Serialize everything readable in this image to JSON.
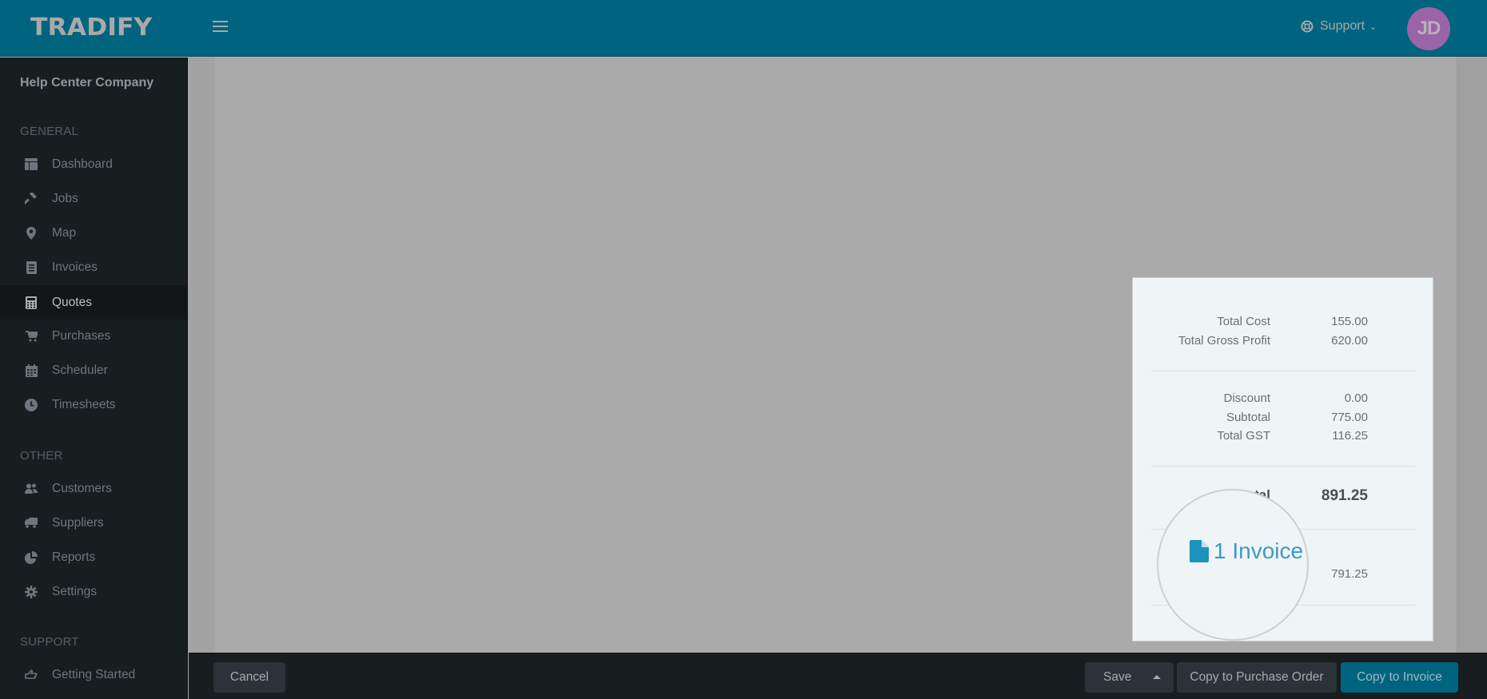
{
  "header": {
    "logo": "TRADIFY",
    "support_label": "Support",
    "avatar_initials": "JD",
    "avatar_color": "#9b64a7",
    "brand_color": "#00637f"
  },
  "sidebar": {
    "company": "Help Center Company",
    "sections": [
      {
        "label": "GENERAL",
        "items": [
          {
            "label": "Dashboard",
            "icon": "dashboard-icon"
          },
          {
            "label": "Jobs",
            "icon": "hammer-icon"
          },
          {
            "label": "Map",
            "icon": "map-pin-icon"
          },
          {
            "label": "Invoices",
            "icon": "invoice-icon"
          },
          {
            "label": "Quotes",
            "icon": "calculator-icon",
            "active": true
          },
          {
            "label": "Purchases",
            "icon": "cart-icon"
          },
          {
            "label": "Scheduler",
            "icon": "calendar-icon"
          },
          {
            "label": "Timesheets",
            "icon": "clock-icon"
          }
        ]
      },
      {
        "label": "OTHER",
        "items": [
          {
            "label": "Customers",
            "icon": "users-icon"
          },
          {
            "label": "Suppliers",
            "icon": "truck-icon"
          },
          {
            "label": "Reports",
            "icon": "pie-chart-icon"
          },
          {
            "label": "Settings",
            "icon": "gear-icon"
          }
        ]
      },
      {
        "label": "SUPPORT",
        "items": [
          {
            "label": "Getting Started",
            "icon": "hand-pointer-icon"
          }
        ]
      }
    ]
  },
  "summary": {
    "total_cost_label": "Total Cost",
    "total_cost": "155.00",
    "gross_profit_label": "Total Gross Profit",
    "gross_profit": "620.00",
    "discount_label": "Discount",
    "discount": "0.00",
    "subtotal_label": "Subtotal",
    "subtotal": "775.00",
    "gst_label": "Total GST",
    "gst": "116.25",
    "total_label": "Total",
    "total": "891.25",
    "invoiced_value": "791.25",
    "invoice_link": "1 Invoice"
  },
  "footer": {
    "cancel": "Cancel",
    "save": "Save",
    "copy_po": "Copy to Purchase Order",
    "copy_invoice": "Copy to Invoice"
  }
}
